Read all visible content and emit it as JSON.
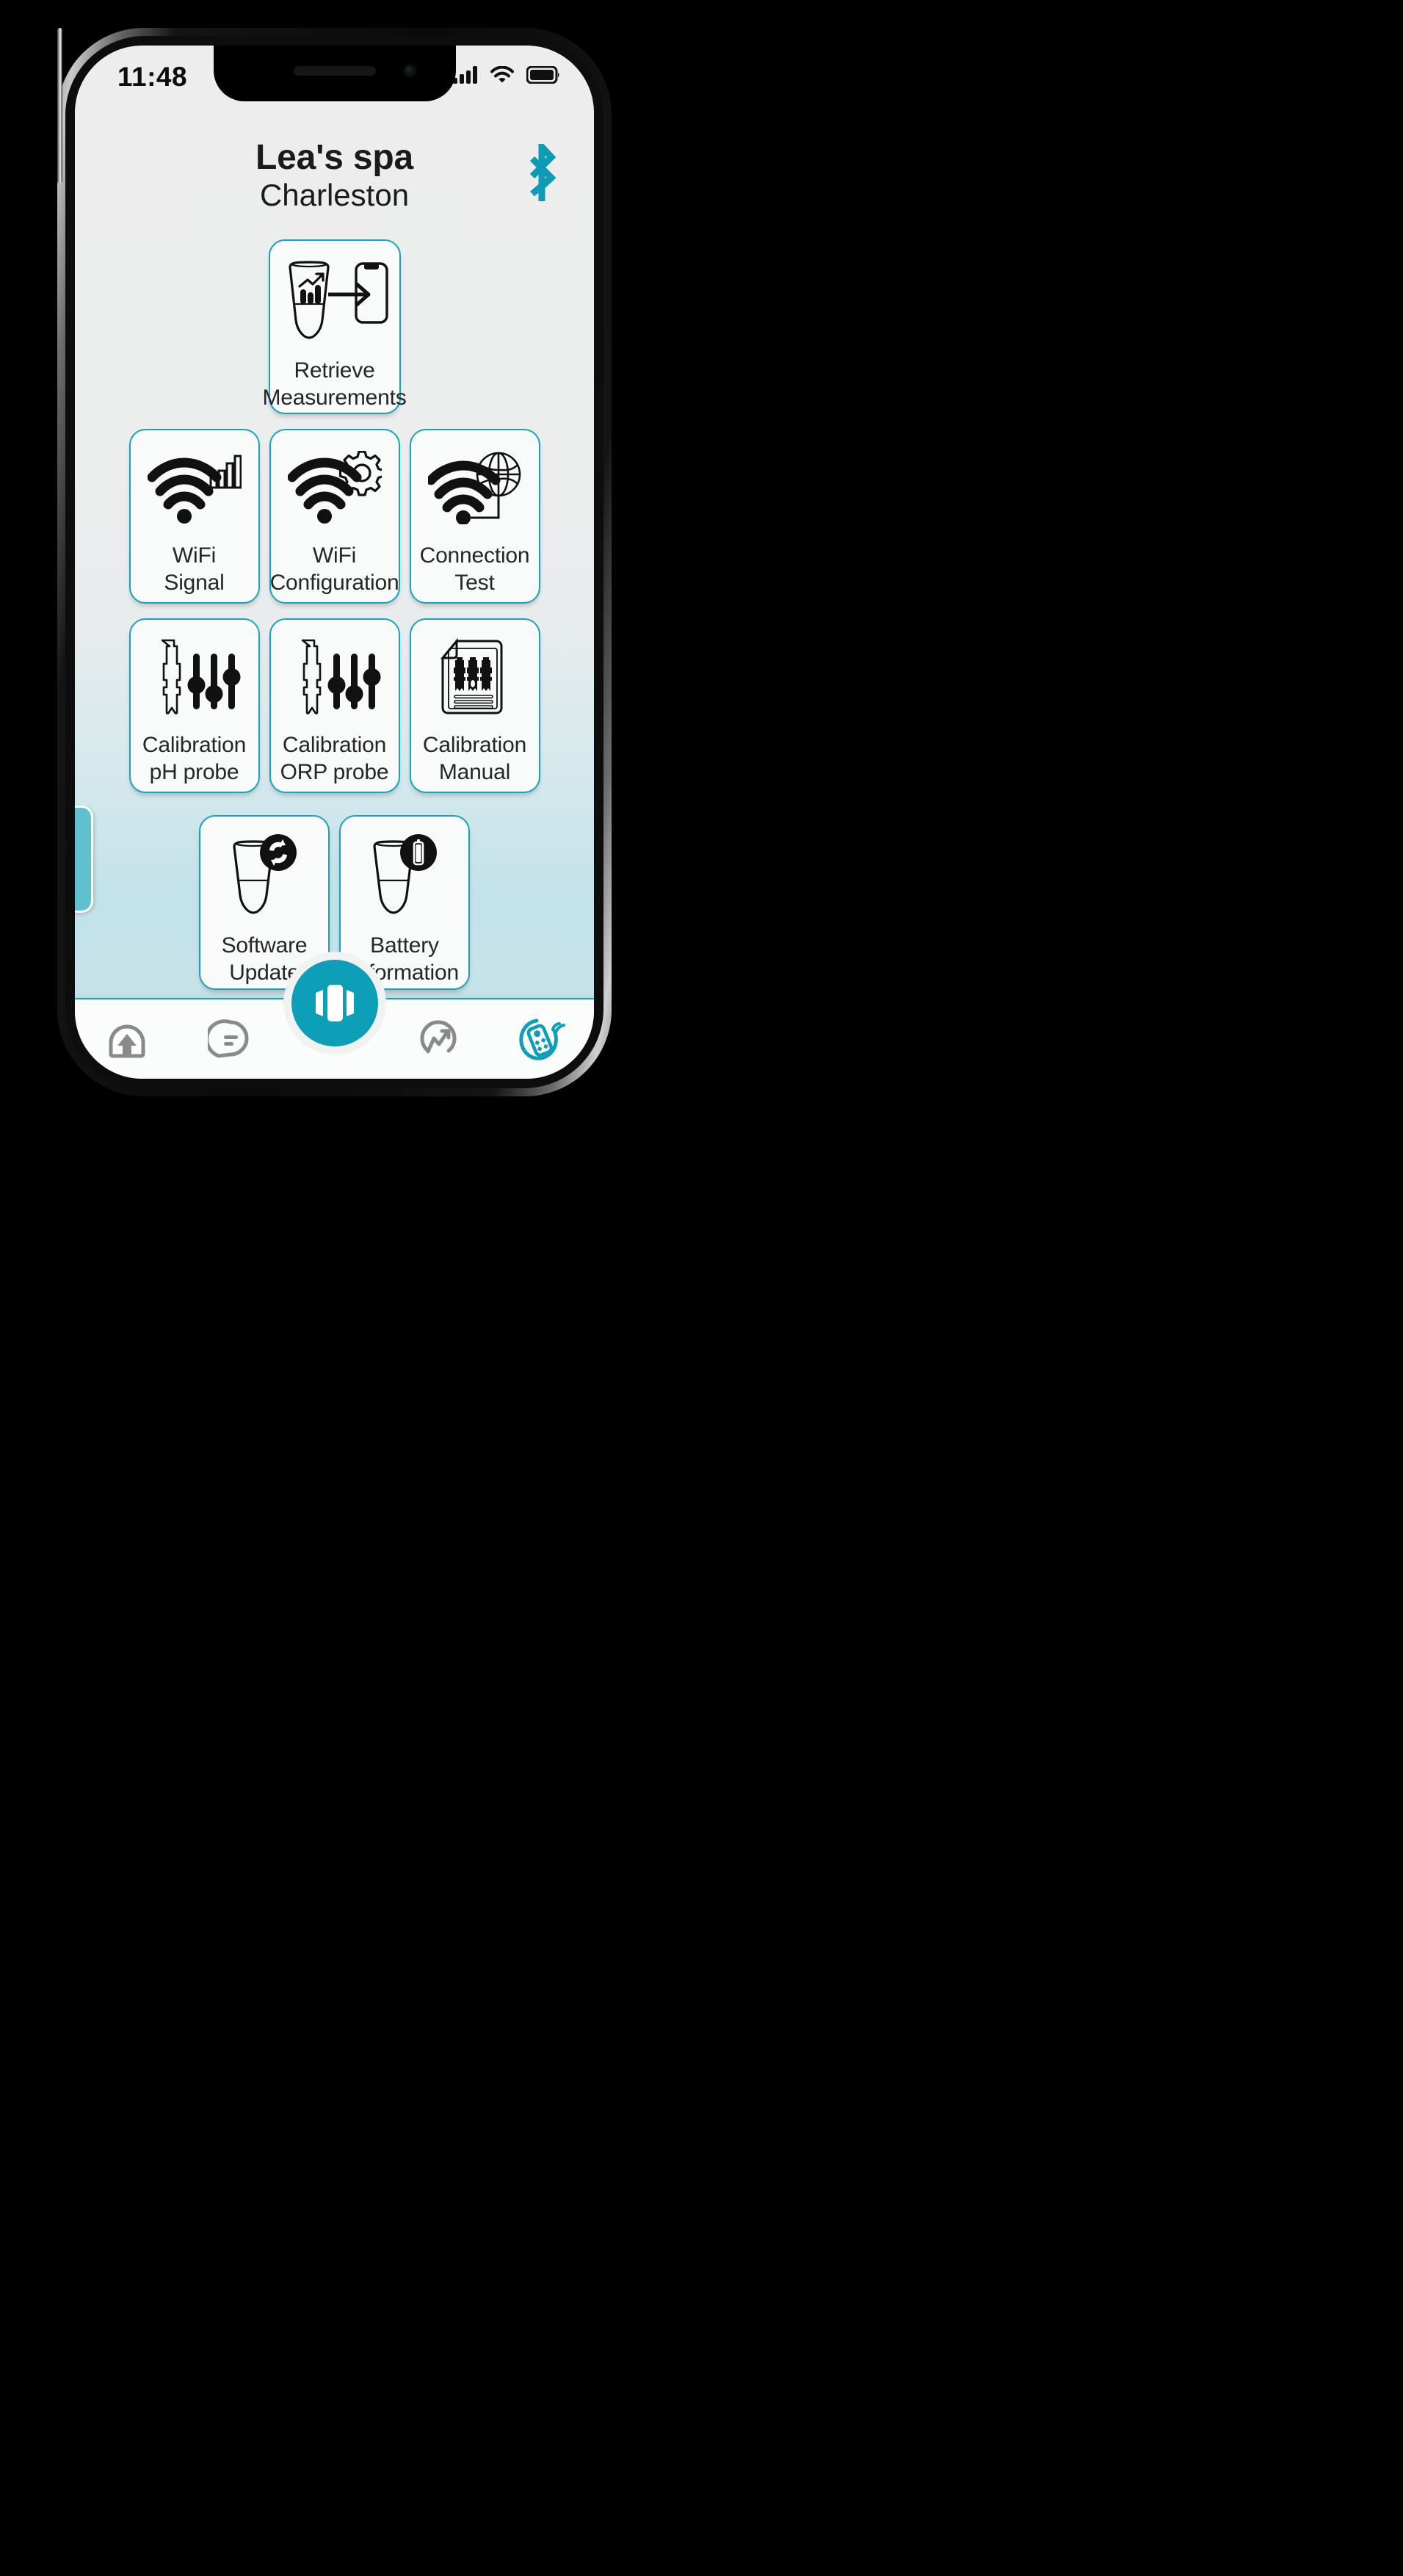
{
  "status_bar": {
    "time": "11:48",
    "icons": [
      "cellular-signal-icon",
      "wifi-icon",
      "battery-full-icon"
    ]
  },
  "header": {
    "title": "Lea's spa",
    "subtitle": "Charleston",
    "bluetooth_icon": "bluetooth-icon"
  },
  "theme": {
    "accent": "#0d9fb8",
    "card_border": "#17a3bd",
    "card_bg": "#f9fafa",
    "screen_bg_top": "#ededed",
    "screen_bg_bottom": "#c6e3e9",
    "nav_inactive": "#8a8a8a",
    "drawer_tab": "#5fc0d0"
  },
  "hero": {
    "label_line1": "Retrieve",
    "label_line2": "Measurements",
    "icon": "probe-to-phone-transfer-icon"
  },
  "grid_rows": [
    [
      {
        "label_line1": "WiFi",
        "label_line2": "Signal",
        "icon": "wifi-signal-bars-icon"
      },
      {
        "label_line1": "WiFi",
        "label_line2": "Configuration",
        "icon": "wifi-gear-icon"
      },
      {
        "label_line1": "Connection",
        "label_line2": "Test",
        "icon": "wifi-globe-icon"
      }
    ],
    [
      {
        "label_line1": "Calibration",
        "label_line2": "pH probe",
        "icon": "probe-sliders-icon"
      },
      {
        "label_line1": "Calibration",
        "label_line2": "ORP probe",
        "icon": "probe-sliders-icon"
      },
      {
        "label_line1": "Calibration",
        "label_line2": "Manual",
        "icon": "document-probes-icon"
      }
    ]
  ],
  "bottom_row": [
    {
      "label_line1": "Software",
      "label_line2": "Update",
      "icon": "probe-sync-icon"
    },
    {
      "label_line1": "Battery",
      "label_line2": "Information",
      "icon": "probe-battery-icon"
    }
  ],
  "drawer": {
    "tab": "side-drawer-handle"
  },
  "nav": {
    "items": [
      {
        "icon": "home-icon",
        "active": false
      },
      {
        "icon": "chat-icon",
        "active": false
      },
      {
        "icon": "trend-icon",
        "active": false
      },
      {
        "icon": "remote-device-icon",
        "active": true
      }
    ],
    "fab": {
      "icon": "carousel-cards-icon"
    }
  }
}
